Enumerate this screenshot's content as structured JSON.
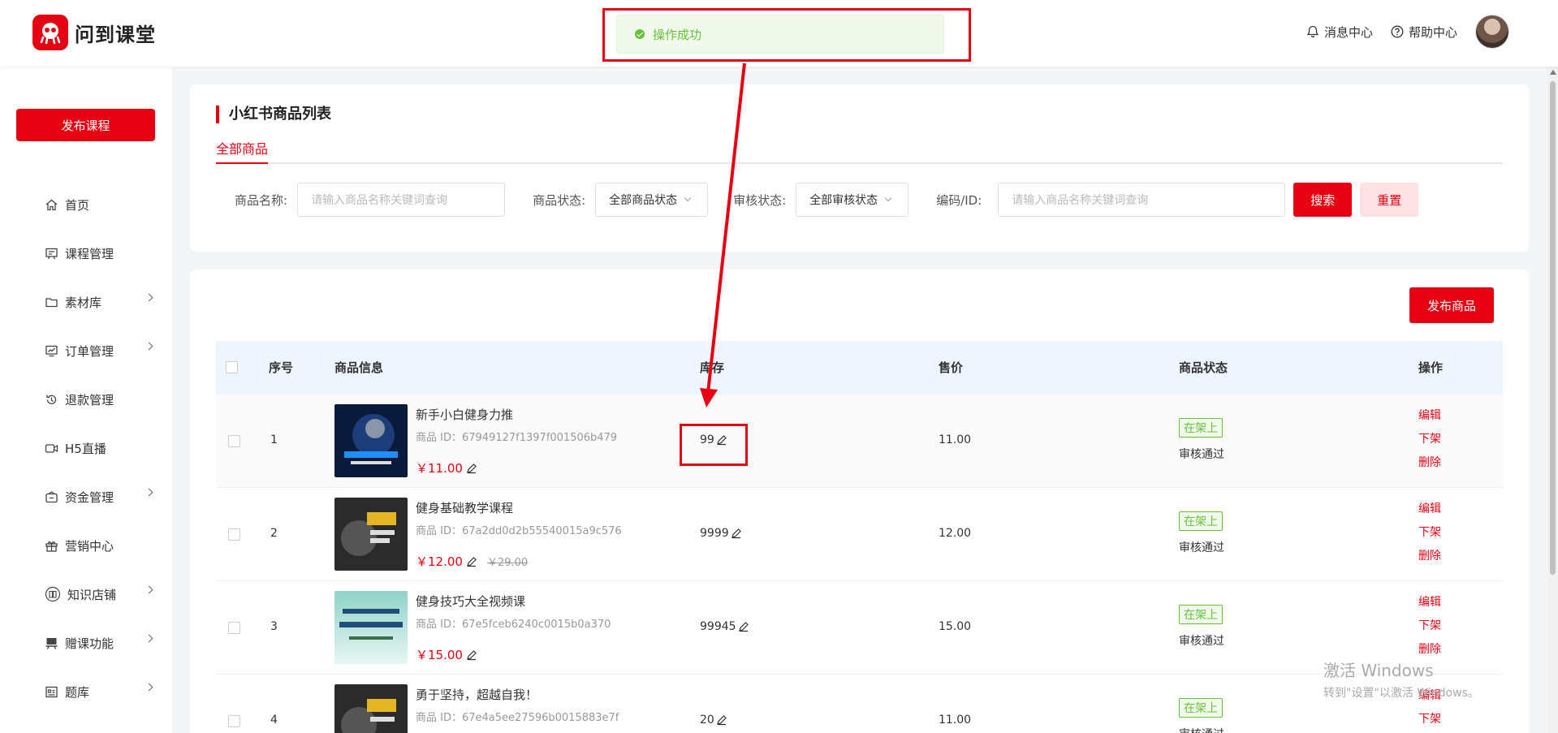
{
  "header": {
    "logo_text": "问到课堂",
    "messages": "消息中心",
    "help": "帮助中心"
  },
  "toast": {
    "message": "操作成功"
  },
  "sidebar": {
    "publish_label": "发布课程",
    "items": [
      {
        "label": "首页",
        "icon": "home-icon",
        "arrow": false
      },
      {
        "label": "课程管理",
        "icon": "course-icon",
        "arrow": false
      },
      {
        "label": "素材库",
        "icon": "folder-icon",
        "arrow": true
      },
      {
        "label": "订单管理",
        "icon": "order-icon",
        "arrow": true
      },
      {
        "label": "退款管理",
        "icon": "refund-icon",
        "arrow": false
      },
      {
        "label": "H5直播",
        "icon": "live-icon",
        "arrow": false
      },
      {
        "label": "资金管理",
        "icon": "wallet-icon",
        "arrow": true
      },
      {
        "label": "营销中心",
        "icon": "gift-icon",
        "arrow": false
      },
      {
        "label": "知识店铺",
        "icon": "shop-icon",
        "arrow": true
      },
      {
        "label": "赠课功能",
        "icon": "present-icon",
        "arrow": true
      },
      {
        "label": "题库",
        "icon": "question-bank-icon",
        "arrow": true
      }
    ]
  },
  "page": {
    "title": "小红书商品列表",
    "tab": "全部商品"
  },
  "filters": {
    "name_label": "商品名称:",
    "name_placeholder": "请输入商品名称关键词查询",
    "status_label": "商品状态:",
    "status_value": "全部商品状态",
    "audit_label": "审核状态:",
    "audit_value": "全部审核状态",
    "code_label": "编码/ID:",
    "code_placeholder": "请输入商品名称关键词查询",
    "search": "搜索",
    "reset": "重置"
  },
  "list": {
    "publish_label": "发布商品",
    "columns": {
      "index": "序号",
      "info": "商品信息",
      "stock": "库存",
      "price": "售价",
      "status": "商品状态",
      "actions": "操作"
    },
    "id_prefix": "商品 ID：",
    "actions": {
      "edit": "编辑",
      "off": "下架",
      "delete": "删除"
    },
    "rows": [
      {
        "index": "1",
        "name": "新手小白健身力推",
        "id": "67949127f1397f001506b479",
        "price": "￥11.00",
        "original": "",
        "stock": "99",
        "sale": "11.00",
        "status": "在架上",
        "audit": "审核通过"
      },
      {
        "index": "2",
        "name": "健身基础教学课程",
        "id": "67a2dd0d2b55540015a9c576",
        "price": "￥12.00",
        "original": "￥29.00",
        "stock": "9999",
        "sale": "12.00",
        "status": "在架上",
        "audit": "审核通过"
      },
      {
        "index": "3",
        "name": "健身技巧大全视频课",
        "id": "67e5fceb6240c0015b0a370",
        "price": "￥15.00",
        "original": "",
        "stock": "99945",
        "sale": "15.00",
        "status": "在架上",
        "audit": "审核通过"
      },
      {
        "index": "4",
        "name": "勇于坚持，超越自我！",
        "id": "67e4a5ee27596b0015883e7f",
        "price": "",
        "original": "",
        "stock": "20",
        "sale": "11.00",
        "status": "在架上",
        "audit": "审核通过"
      }
    ]
  },
  "watermark": {
    "line1": "激活 Windows",
    "line2": "转到\"设置\"以激活 Windows。"
  },
  "colors": {
    "accent": "#e60012",
    "success": "#67c23a",
    "table_header": "#eef5fc"
  }
}
